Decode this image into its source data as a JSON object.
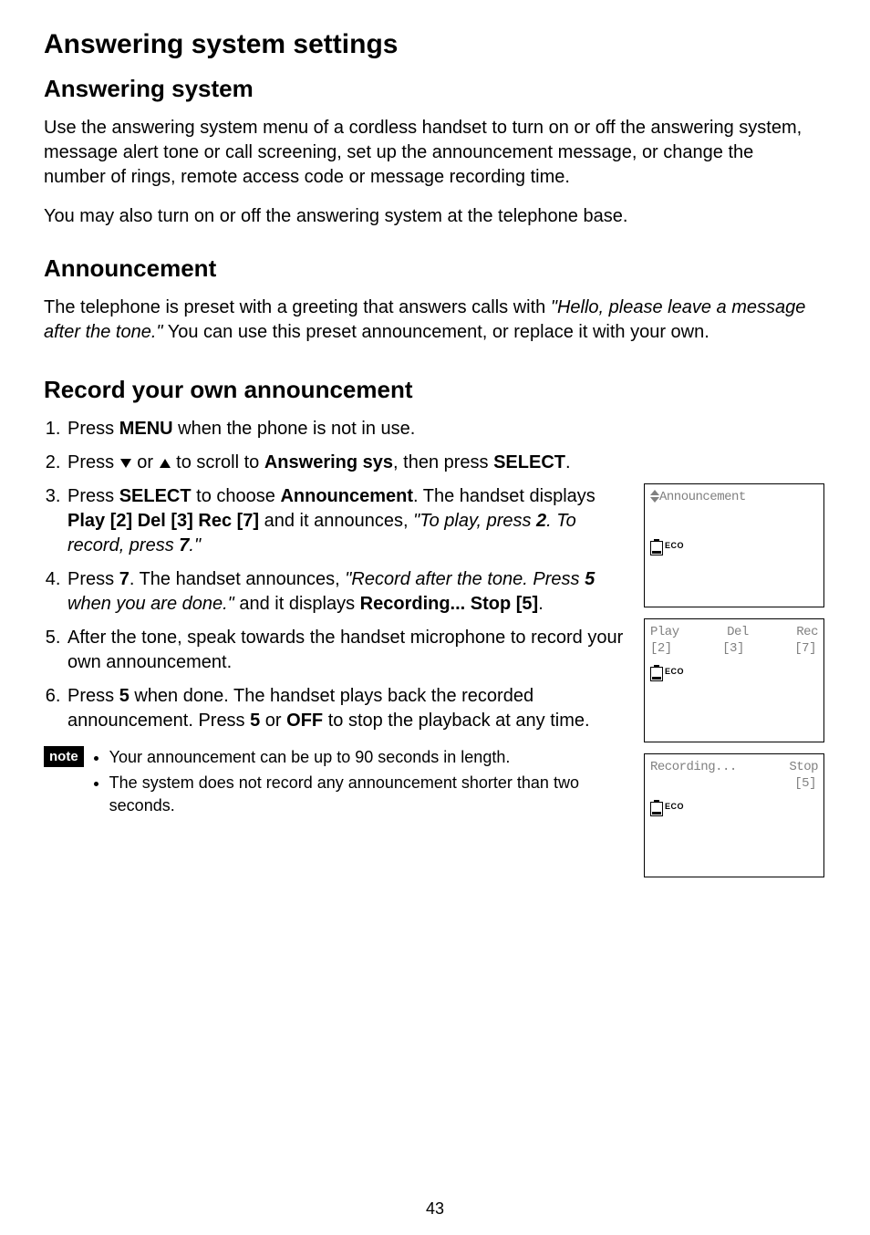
{
  "page_number": "43",
  "h1": "Answering system settings",
  "section1": {
    "heading": "Answering system",
    "para1": "Use the answering system menu of a cordless handset to turn on or off the answering system, message alert tone or call screening, set up the announcement message, or change the number of rings, remote access code or message recording time.",
    "para2": "You may also turn on or off the answering system at the telephone base."
  },
  "section2": {
    "heading": "Announcement",
    "para_pre": "The telephone is preset with a greeting that answers calls with ",
    "para_quote": "\"Hello, please leave a message after the tone.\"",
    "para_post": "  You can use this preset announcement, or replace it with your own."
  },
  "section3": {
    "heading": "Record your own announcement",
    "steps": {
      "s1_pre": "Press ",
      "s1_menu": "MENU",
      "s1_post": " when the phone is not in use.",
      "s2_pre": "Press ",
      "s2_or": " or ",
      "s2_mid": " to scroll to ",
      "s2_item": "Answering sys",
      "s2_then": ", then press ",
      "s2_select": "SELECT",
      "s2_end": ".",
      "s3_a": "Press ",
      "s3_select": "SELECT",
      "s3_b": " to choose ",
      "s3_item": "Announcement",
      "s3_c": ". The handset displays ",
      "s3_display": "Play [2] Del [3] Rec [7]",
      "s3_d": " and it announces, ",
      "s3_quote_a": "\"To play, press ",
      "s3_quote_2": "2",
      "s3_quote_b": ". To record, press ",
      "s3_quote_7": "7",
      "s3_quote_c": ".\"",
      "s4_a": "Press ",
      "s4_7": "7",
      "s4_b": ". The handset announces, ",
      "s4_quote_a": "\"Record after the tone. Press ",
      "s4_quote_5": "5",
      "s4_quote_b": " when you are done.\"",
      "s4_c": "  and it displays ",
      "s4_disp": "Recording... Stop [5]",
      "s4_d": ".",
      "s5": "After the tone, speak towards the handset microphone to record your own announcement.",
      "s6_a": "Press ",
      "s6_5a": "5",
      "s6_b": " when done. The handset plays back the recorded announcement. Press ",
      "s6_5b": "5",
      "s6_c": " or ",
      "s6_off": "OFF",
      "s6_d": " to stop the playback at any time."
    },
    "note_label": "note",
    "notes": {
      "n1": "Your announcement can be up to 90 seconds in length.",
      "n2": "The system does not record any announcement shorter than two seconds."
    }
  },
  "screens": {
    "scr1_title": "Announcement",
    "eco": "ECO",
    "scr2_play": "Play",
    "scr2_del": "Del",
    "scr2_rec": "Rec",
    "scr2_2": "[2]",
    "scr2_3": "[3]",
    "scr2_7": "[7]",
    "scr3_rec": "Recording...",
    "scr3_stop": "Stop",
    "scr3_5": "[5]"
  }
}
